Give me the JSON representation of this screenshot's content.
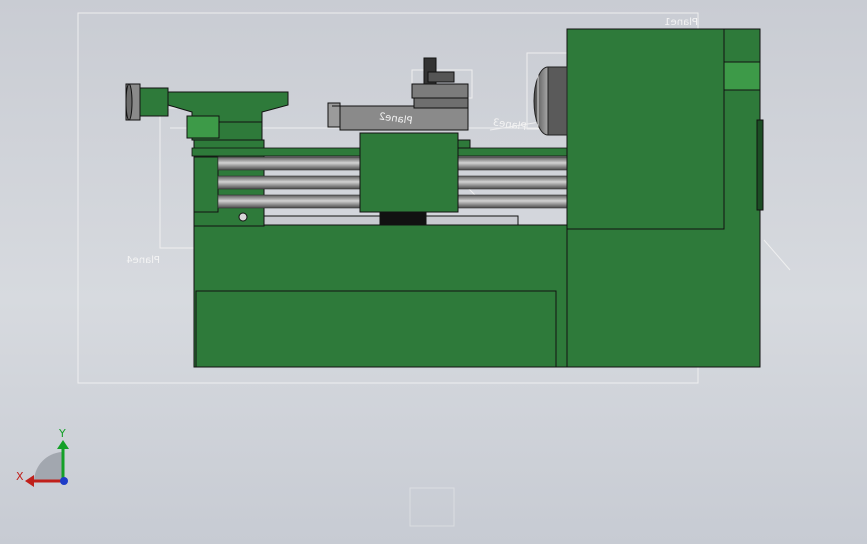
{
  "viewport": {
    "background_top": "#c9ccd3",
    "background_bottom": "#c7cbd3"
  },
  "model": {
    "body_color": "#2e7a3a",
    "body_color_light": "#3d9a48",
    "edge_color": "#111111",
    "steel_color": "#8a8a8a"
  },
  "planes": {
    "plane1": "Plane1",
    "plane2": "Plane2",
    "plane3": "Plane3",
    "plane4": "Plane4"
  },
  "triad": {
    "x_label": "X",
    "y_label": "Y",
    "x_color": "#c0201b",
    "y_color": "#14a028",
    "z_color": "#1e3cc8"
  }
}
